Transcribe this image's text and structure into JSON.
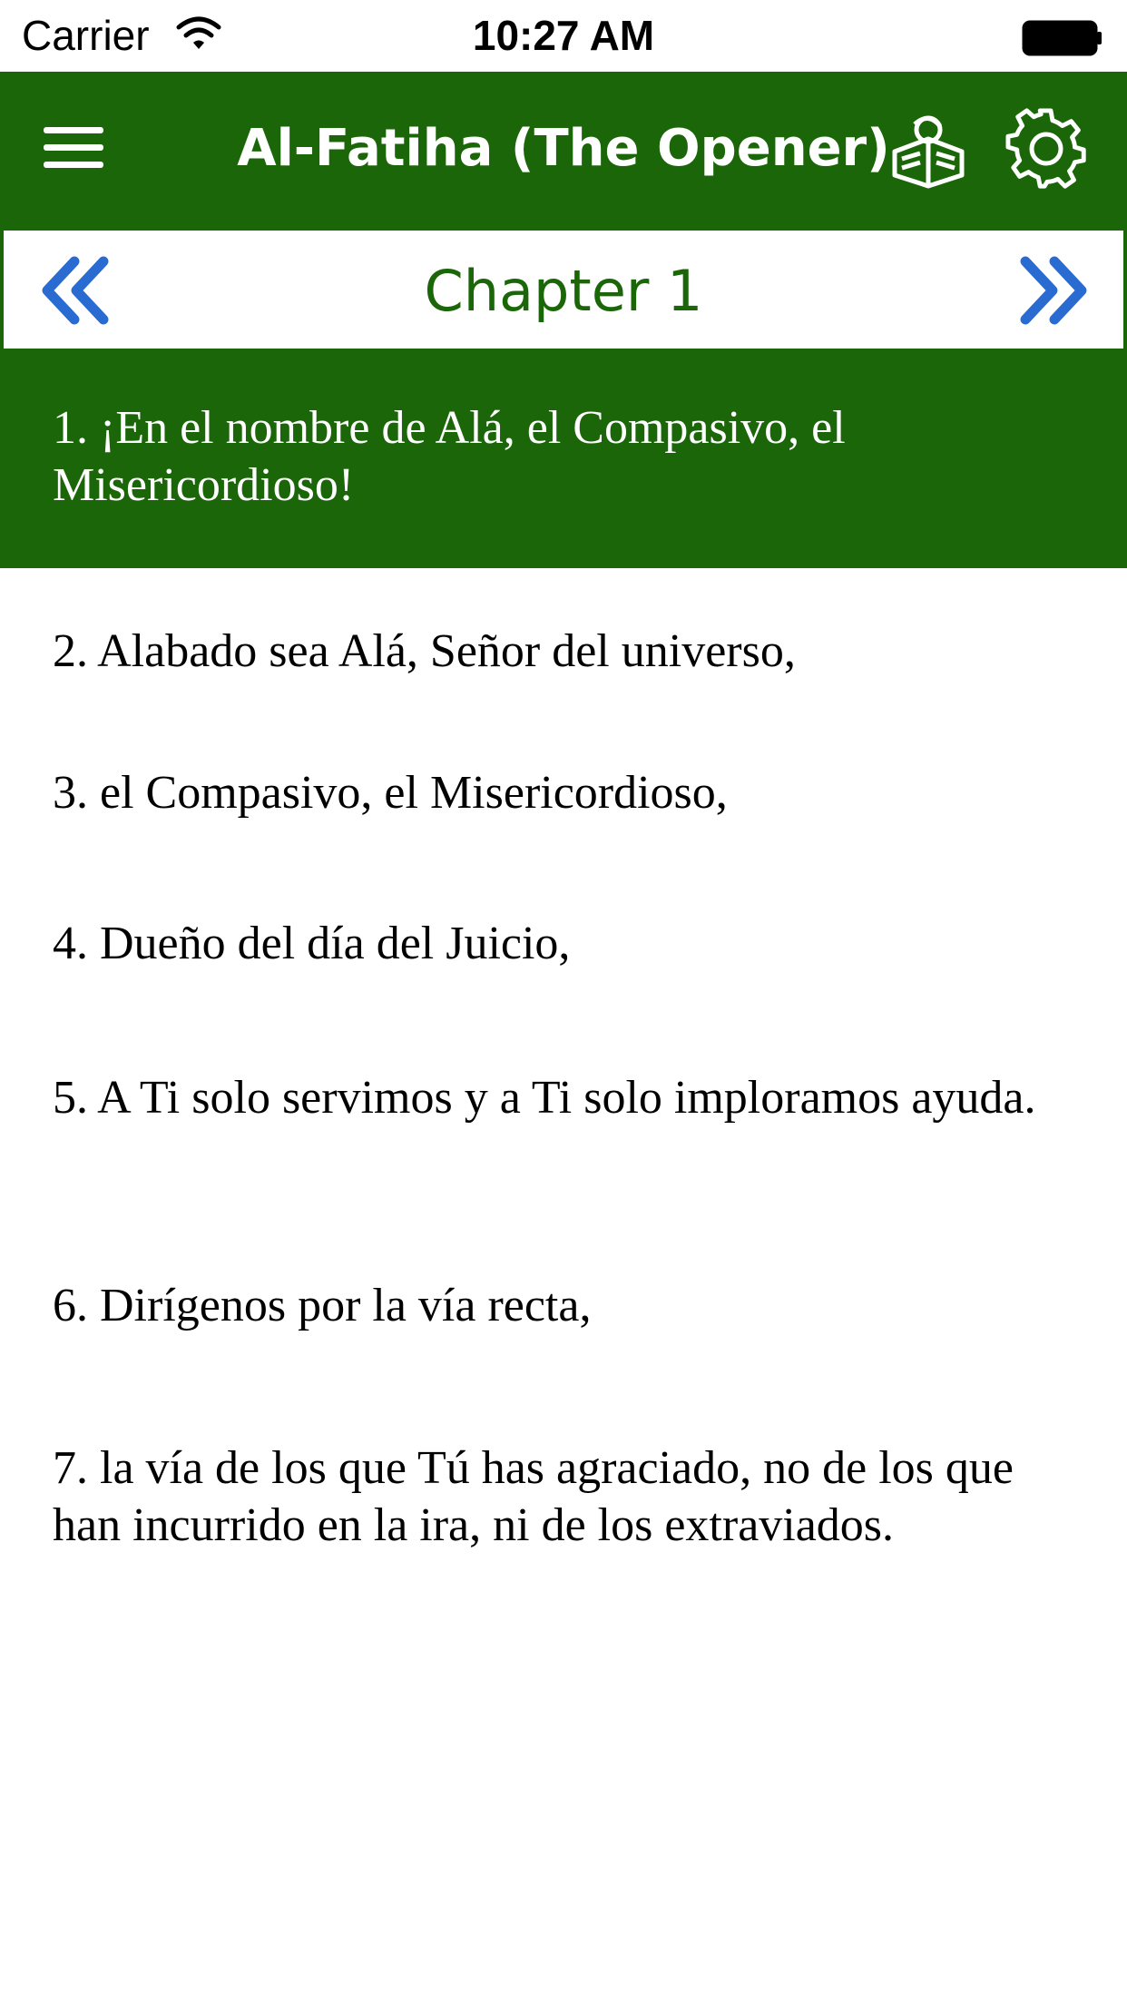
{
  "status_bar": {
    "carrier": "Carrier",
    "time": "10:27 AM"
  },
  "nav": {
    "title": "Al-Fatiha (The Opener)",
    "icons": [
      "menu-icon",
      "reading-icon",
      "gear-icon"
    ]
  },
  "chapter": {
    "label": "Chapter 1",
    "prev_icon": "double-chevron-left-icon",
    "next_icon": "double-chevron-right-icon"
  },
  "verses": [
    "1. ¡En el nombre de Alá, el Compasivo, el Misericordioso!",
    "2. Alabado sea Alá, Señor del universo,",
    "3. el Compasivo, el Misericordioso,",
    "4. Dueño del día del Juicio,",
    "5. A Ti solo servimos y a Ti solo imploramos ayuda.",
    "6. Dirígenos por la vía recta,",
    "7. la vía de los que Tú has agraciado, no de los que han incurrido en la ira, ni de los extraviados."
  ],
  "colors": {
    "primary_green": "#1a6608",
    "chevron_blue": "#2a6bd1",
    "selected_text": "#ffffff"
  }
}
